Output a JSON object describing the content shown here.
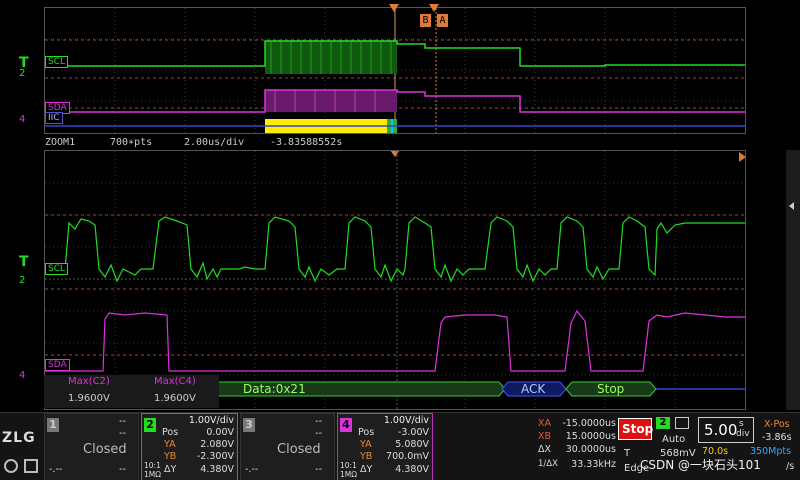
{
  "markers": {
    "b": "B",
    "a": "A"
  },
  "channels": {
    "scl_label": "SCL",
    "sda_label": "SDA",
    "iic_label": "IIC",
    "t_symbol": "T",
    "level_2": "2",
    "level_4": "4"
  },
  "zoom": {
    "name": "ZOOM1",
    "pts": "700∗pts",
    "timebase": "2.00us/div",
    "offset": "-3.83588552s"
  },
  "measurements": {
    "m1_name": "Max(C2)",
    "m1_value": "1.9600V",
    "m2_name": "Max(C4)",
    "m2_value": "1.9600V"
  },
  "decode": {
    "data_label": "Data:0x21",
    "ack_label": "ACK",
    "stop_label": "Stop"
  },
  "ch1": {
    "num": "1",
    "dash1": "--",
    "dash2": "--",
    "state": "Closed",
    "dash3": "-.--",
    "dash4": "--"
  },
  "ch2": {
    "num": "2",
    "vdiv": "1.00V/div",
    "pos_label": "Pos",
    "pos": "0.00V",
    "ya_label": "YA",
    "ya": "2.080V",
    "yb_label": "YB",
    "yb": "-2.300V",
    "coupling": "10:1",
    "impedance": "1MΩ",
    "dy_label": "ΔY",
    "dy": "4.380V"
  },
  "ch3": {
    "num": "3",
    "dash1": "--",
    "dash2": "--",
    "state": "Closed",
    "dash3": "-.--",
    "dash4": "--"
  },
  "ch4": {
    "num": "4",
    "vdiv": "1.00V/div",
    "pos_label": "Pos",
    "pos": "-3.00V",
    "ya_label": "YA",
    "ya": "5.080V",
    "yb_label": "YB",
    "yb": "700.0mV",
    "coupling": "10:1",
    "impedance": "1MΩ",
    "dy_label": "ΔY",
    "dy": "4.380V"
  },
  "cursors": {
    "xa_label": "XA",
    "xa": "-15.0000us",
    "xb_label": "XB",
    "xb": "15.0000us",
    "dx_label": "ΔX",
    "dx": "30.0000us",
    "inv_label": "1/ΔX",
    "inv": "33.33kHz"
  },
  "acq": {
    "stop": "Stop",
    "trig_src": "2",
    "mode": "Auto",
    "t_label": "T",
    "t_level": "568mV",
    "edge": "Edge"
  },
  "timebase": {
    "value": "5.00",
    "unit_top": "s",
    "unit_bottom": "div",
    "xpos_label": "X-Pos",
    "xpos": "-3.86s",
    "xpos2": "70.0s",
    "rate": "350Mpts",
    "srate": "/s"
  },
  "brand": {
    "logo": "ZLG"
  },
  "watermark": "CSDN @一块石头101"
}
